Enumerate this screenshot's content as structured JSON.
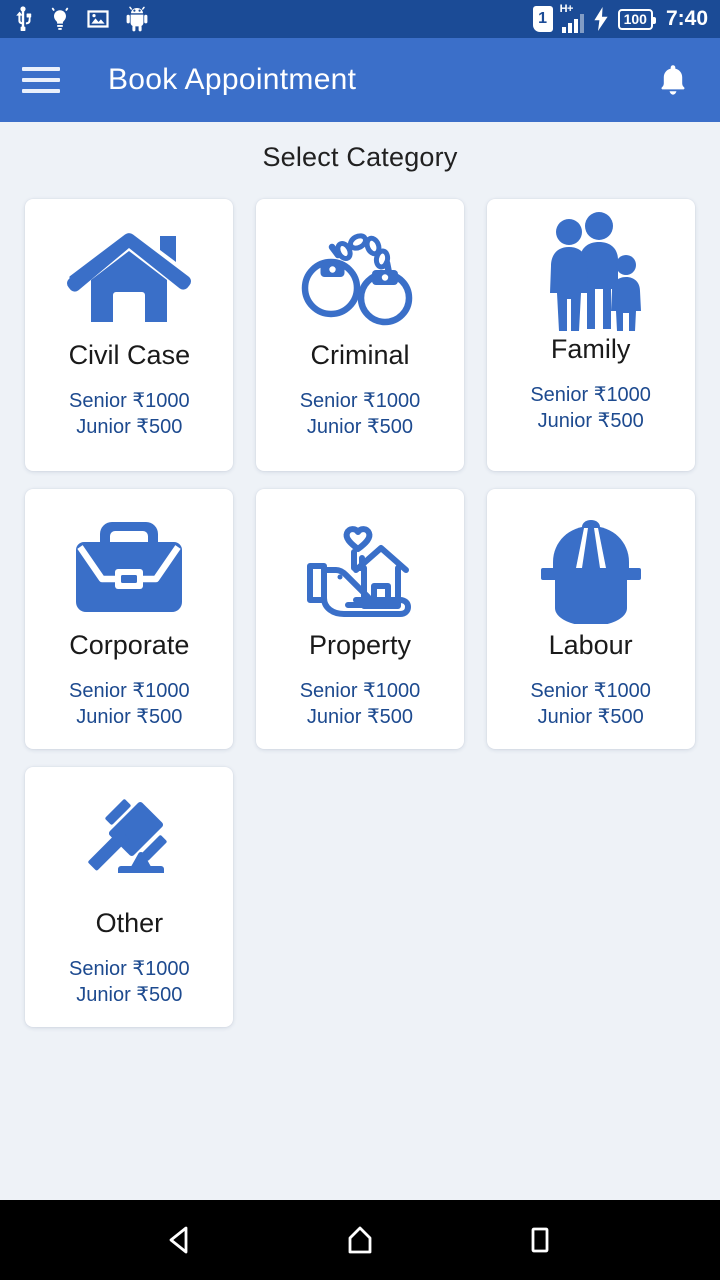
{
  "status_bar": {
    "background": "#1b4b96",
    "icons": [
      "usb-icon",
      "bulb-icon",
      "image-icon",
      "android-debug-icon"
    ],
    "sim_label": "1",
    "network_type": "H+",
    "battery_level": "100",
    "charging": true,
    "time": "7:40"
  },
  "app_bar": {
    "background": "#3b6fc9",
    "menu_icon": "hamburger-menu-icon",
    "title": "Book Appointment",
    "notification_icon": "bell-icon"
  },
  "content": {
    "background": "#eef2f7",
    "page_title": "Select Category",
    "accent_color": "#3a6fc8",
    "fee_color": "#1d4a8f",
    "categories": [
      {
        "name": "Civil Case",
        "icon": "house-icon",
        "senior_fee": "Senior ₹1000",
        "junior_fee": "Junior ₹500",
        "highlighted": false
      },
      {
        "name": "Criminal",
        "icon": "handcuffs-icon",
        "senior_fee": "Senior ₹1000",
        "junior_fee": "Junior ₹500",
        "highlighted": false
      },
      {
        "name": "Family",
        "icon": "family-icon",
        "senior_fee": "Senior ₹1000",
        "junior_fee": "Junior ₹500",
        "highlighted": true
      },
      {
        "name": "Corporate",
        "icon": "briefcase-icon",
        "senior_fee": "Senior ₹1000",
        "junior_fee": "Junior ₹500",
        "highlighted": false
      },
      {
        "name": "Property",
        "icon": "hand-holding-house-heart-icon",
        "senior_fee": "Senior ₹1000",
        "junior_fee": "Junior ₹500",
        "highlighted": false
      },
      {
        "name": "Labour",
        "icon": "hard-hat-icon",
        "senior_fee": "Senior ₹1000",
        "junior_fee": "Junior ₹500",
        "highlighted": false
      },
      {
        "name": "Other",
        "icon": "gavel-icon",
        "senior_fee": "Senior ₹1000",
        "junior_fee": "Junior ₹500",
        "highlighted": false
      }
    ]
  },
  "nav_bar": {
    "background": "#000000",
    "buttons": [
      "back-icon",
      "home-icon",
      "recents-icon"
    ]
  }
}
